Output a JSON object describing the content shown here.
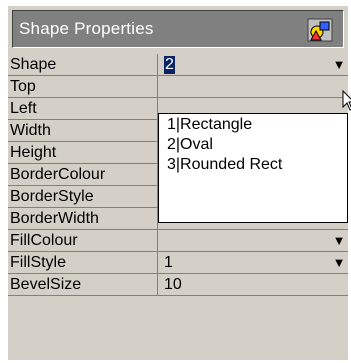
{
  "title": "Shape Properties",
  "title_icon": "shapes-icon",
  "rows": [
    {
      "label": "Shape",
      "value": "2",
      "dropdown": true,
      "selected": true
    },
    {
      "label": "Top",
      "value": "",
      "dropdown": false
    },
    {
      "label": "Left",
      "value": "",
      "dropdown": false
    },
    {
      "label": "Width",
      "value": "",
      "dropdown": false
    },
    {
      "label": "Height",
      "value": "",
      "dropdown": false
    },
    {
      "label": "BorderColour",
      "value": "",
      "dropdown": false
    },
    {
      "label": "BorderStyle",
      "value": "",
      "dropdown": true
    },
    {
      "label": "BorderWidth",
      "value": "",
      "dropdown": false
    },
    {
      "label": "FillColour",
      "value": "",
      "dropdown": true
    },
    {
      "label": "FillStyle",
      "value": "1",
      "dropdown": true
    },
    {
      "label": "BevelSize",
      "value": "10",
      "dropdown": false
    }
  ],
  "shape_options": [
    "1|Rectangle",
    "2|Oval",
    "3|Rounded Rect"
  ],
  "colors": {
    "panel": "#d4d0c8",
    "title_bg": "#808080",
    "selection": "#0a246a"
  }
}
